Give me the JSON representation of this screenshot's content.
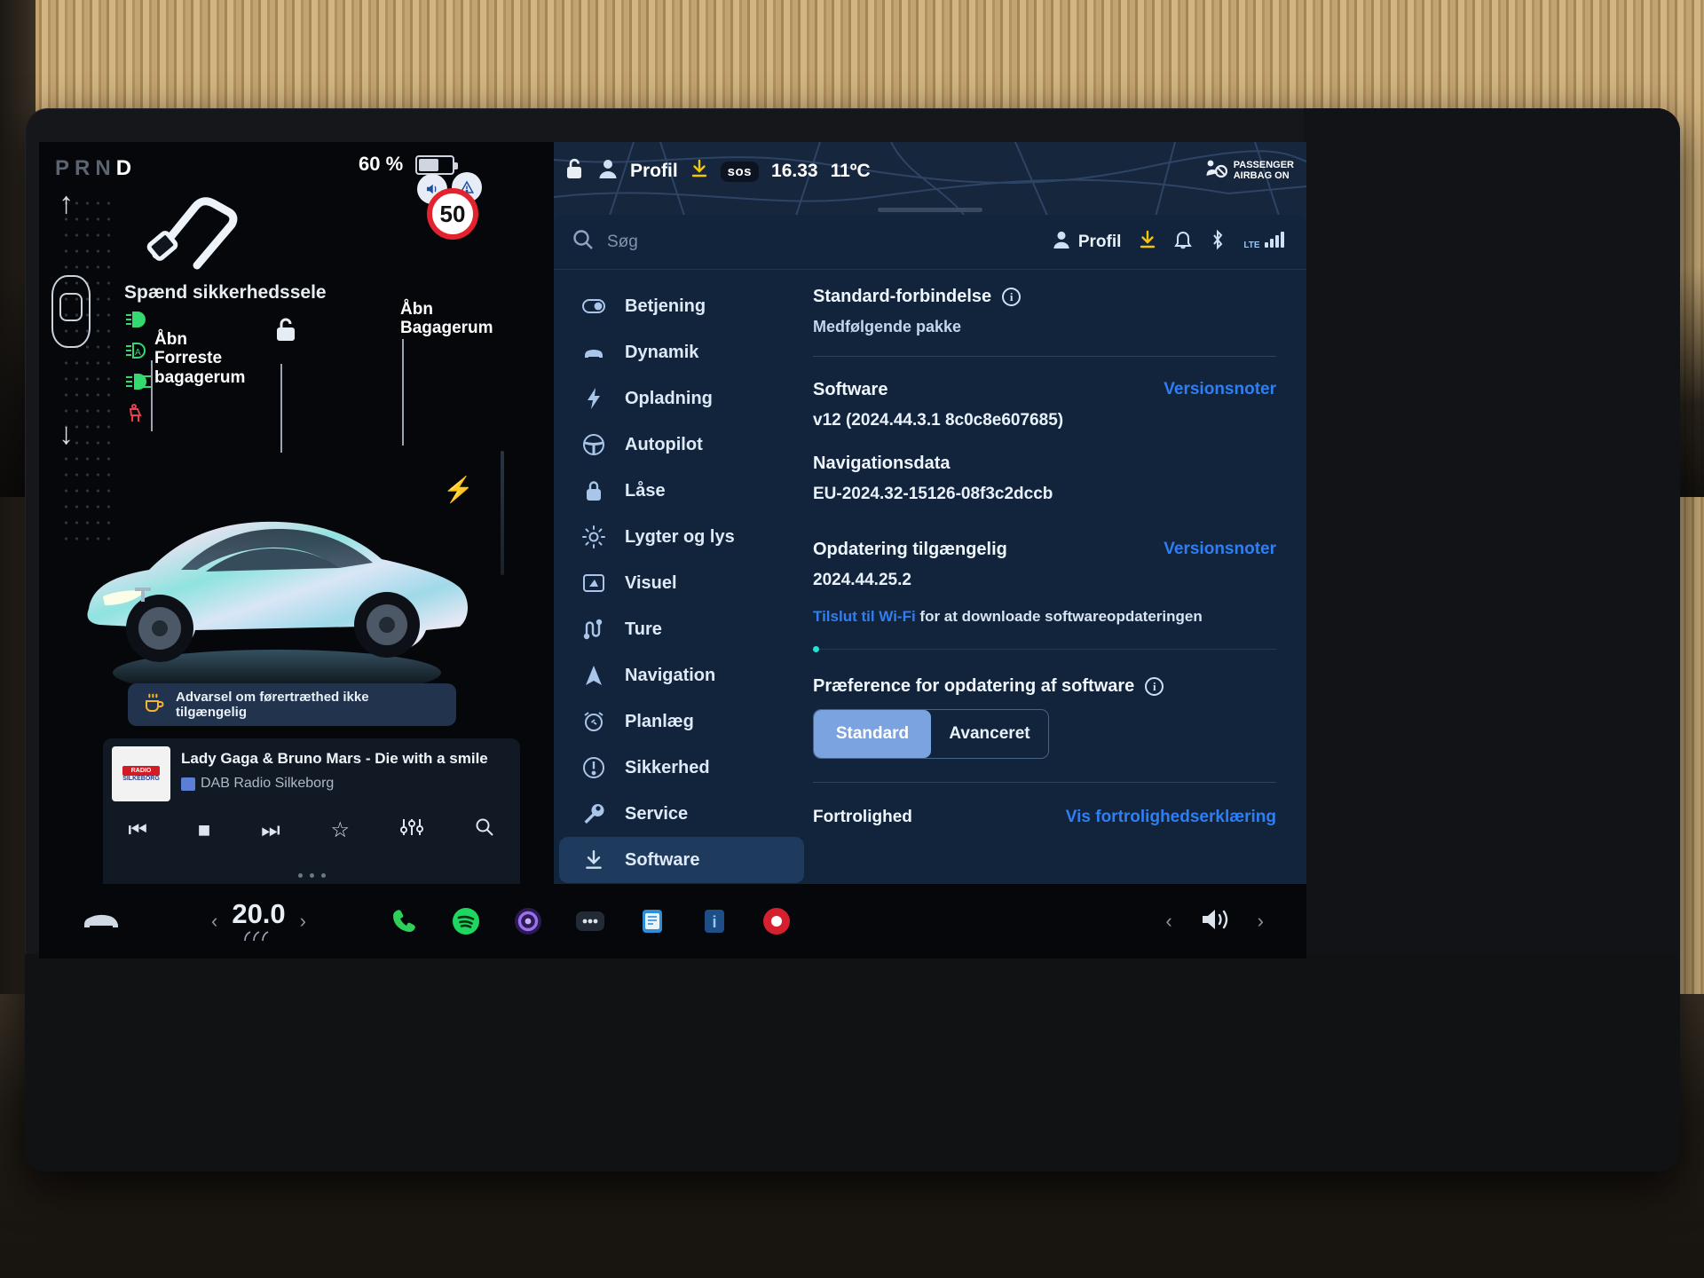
{
  "drive": {
    "prnd": {
      "letters": [
        "P",
        "R",
        "N",
        "D"
      ],
      "active": "D"
    },
    "battery_percent": "60 %",
    "battery_fill": 55,
    "seatbelt_warning": "Spænd sikkerhedssele",
    "frunk_label": "Åbn\nForreste\nbagagerum",
    "frunk_label_line1": "Åbn",
    "frunk_label_line2": "Forreste",
    "frunk_label_line3": "bagagerum",
    "trunk_label_line1": "Åbn",
    "trunk_label_line2": "Bagagerum",
    "speed_limit": "50",
    "driver_warning": "Advarsel om førertræthed ikke tilgængelig",
    "driver_warning_icon": "coffee-cup-icon",
    "indicators": [
      {
        "name": "headlight-icon",
        "color": "#34d96f"
      },
      {
        "name": "auto-headlight-icon",
        "color": "#34d96f"
      },
      {
        "name": "fog-light-icon",
        "color": "#34d96f"
      },
      {
        "name": "seatbelt-alert-icon",
        "color": "#e8414d"
      }
    ]
  },
  "media": {
    "track_title": "Lady Gaga & Bruno Mars - Die with a smile",
    "station": "DAB Radio Silkeborg",
    "album_line1": "RADIO",
    "album_line2": "SILKEBORG",
    "controls": [
      {
        "name": "previous-track-button",
        "glyph": "⏮"
      },
      {
        "name": "stop-button",
        "glyph": "■"
      },
      {
        "name": "next-track-button",
        "glyph": "⏭"
      },
      {
        "name": "favorite-button",
        "glyph": "☆"
      },
      {
        "name": "equalizer-button",
        "glyph": "⫶"
      },
      {
        "name": "search-button",
        "glyph": "⚲"
      }
    ],
    "page_dots": 3
  },
  "statusbar": {
    "battery_percent": "60 %",
    "profile": "Profil",
    "sos": "sos",
    "time": "16.33",
    "temperature": "11ºC",
    "airbag_line1": "PASSENGER",
    "airbag_line2": "AIRBAG ON"
  },
  "settings_header": {
    "search_placeholder": "Søg",
    "profile": "Profil",
    "network": "LTE"
  },
  "menu": {
    "items": [
      {
        "label": "Betjening",
        "icon": "toggle-switch-icon",
        "active": false
      },
      {
        "label": "Dynamik",
        "icon": "car-front-icon",
        "active": false
      },
      {
        "label": "Opladning",
        "icon": "lightning-bolt-icon",
        "active": false
      },
      {
        "label": "Autopilot",
        "icon": "steering-wheel-icon",
        "active": false
      },
      {
        "label": "Låse",
        "icon": "lock-icon",
        "active": false
      },
      {
        "label": "Lygter og lys",
        "icon": "sun-light-icon",
        "active": false
      },
      {
        "label": "Visuel",
        "icon": "display-icon",
        "active": false
      },
      {
        "label": "Ture",
        "icon": "road-trip-icon",
        "active": false
      },
      {
        "label": "Navigation",
        "icon": "navigation-arrow-icon",
        "active": false
      },
      {
        "label": "Planlæg",
        "icon": "alarm-clock-icon",
        "active": false
      },
      {
        "label": "Sikkerhed",
        "icon": "exclamation-circle-icon",
        "active": false
      },
      {
        "label": "Service",
        "icon": "wrench-icon",
        "active": false
      },
      {
        "label": "Software",
        "icon": "download-icon",
        "active": true
      }
    ]
  },
  "software": {
    "connectivity_title": "Standard-forbindelse",
    "connectivity_sub": "Medfølgende pakke",
    "software_label": "Software",
    "software_version": "v12 (2024.44.3.1 8c0c8e607685)",
    "release_notes_1": "Versionsnoter",
    "navdata_label": "Navigationsdata",
    "navdata_version": "EU-2024.32-15126-08f3c2dccb",
    "update_label": "Opdatering tilgængelig",
    "update_version": "2024.44.25.2",
    "release_notes_2": "Versionsnoter",
    "wifi_link": "Tilslut til Wi-Fi",
    "wifi_rest": " for at downloade softwareopdateringen",
    "pref_title": "Præference for opdatering af software",
    "pref_options": [
      {
        "label": "Standard",
        "selected": true
      },
      {
        "label": "Avanceret",
        "selected": false
      }
    ],
    "privacy_label": "Fortrolighed",
    "privacy_link": "Vis fortrolighedserklæring"
  },
  "bottombar": {
    "temperature": "20.0",
    "left_chevron": "‹",
    "right_chevron": "›",
    "apps": [
      {
        "name": "phone-app-icon",
        "color": "#2fd05a"
      },
      {
        "name": "spotify-app-icon",
        "color": "#1ed760"
      },
      {
        "name": "media-app-icon",
        "color": "#8a5bd6"
      },
      {
        "name": "more-apps-icon",
        "color": "#2a3240"
      },
      {
        "name": "calendar-app-icon",
        "color": "#4aa3e8"
      },
      {
        "name": "info-app-icon",
        "color": "#3d8fd6"
      },
      {
        "name": "camera-app-icon",
        "color": "#e02b3a"
      }
    ],
    "volume_icon": "speaker-icon"
  },
  "colors": {
    "accent_blue": "#2f7ff2",
    "panel_bg": "#12243c",
    "selected_seg": "#7aa3e0",
    "green_indicator": "#34d96f",
    "progress_dot": "#26e0d4"
  }
}
